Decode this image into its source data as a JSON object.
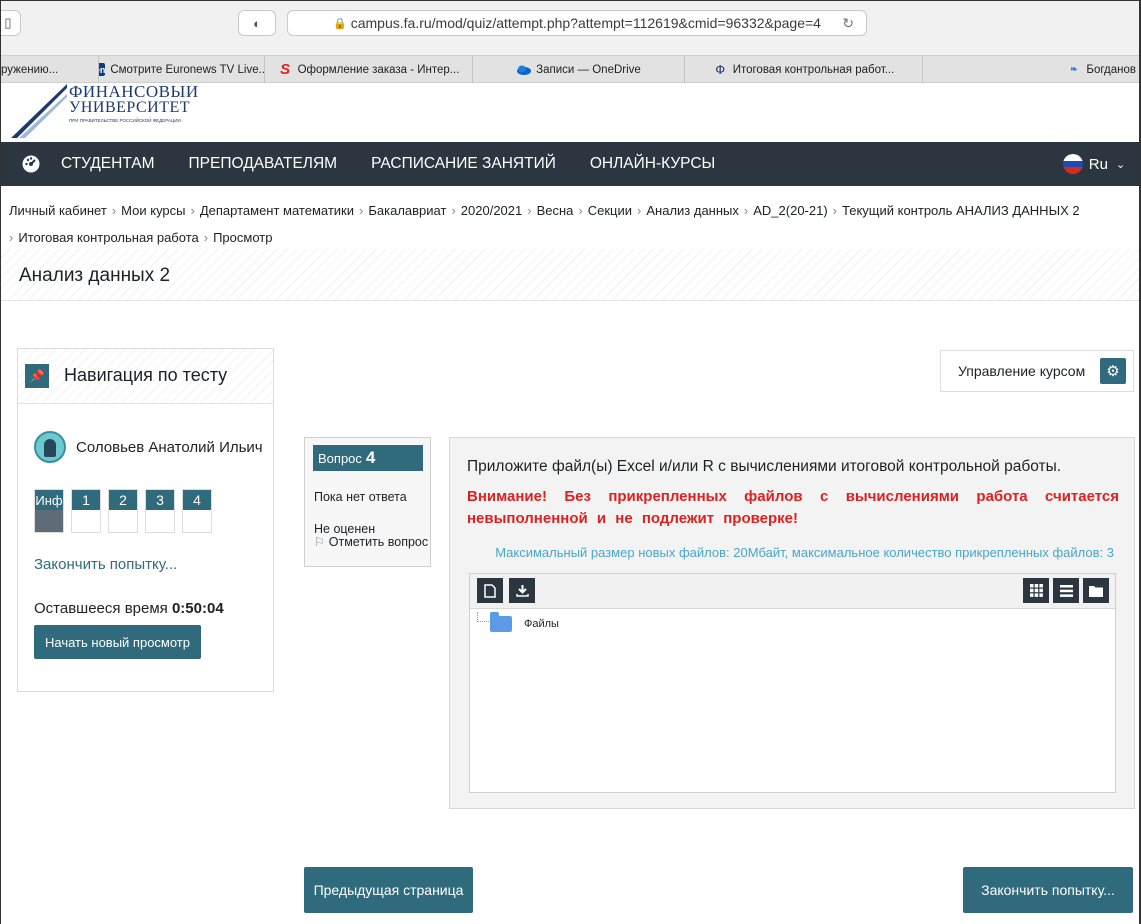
{
  "browser": {
    "url": "campus.fa.ru/mod/quiz/attempt.php?attempt=112619&cmid=96332&page=4",
    "tabs": [
      {
        "label": "ружению...",
        "favicon": ""
      },
      {
        "label": "Смотрите Euronews TV Live...",
        "favicon": "en"
      },
      {
        "label": "Оформление заказа - Интер...",
        "favicon": "S"
      },
      {
        "label": "Записи — OneDrive",
        "favicon": "cloud"
      },
      {
        "label": "Итоговая контрольная работ...",
        "favicon": "Ф"
      },
      {
        "label": "Богданов",
        "favicon": "leaf"
      }
    ]
  },
  "logo": {
    "line1": "ФИНАНСОВЫЙ",
    "line2": "УНИВЕРСИТЕТ",
    "line3": "ПРИ ПРАВИТЕЛЬСТВЕ РОССИЙСКОЙ ФЕДЕРАЦИИ"
  },
  "nav": {
    "items": [
      "СТУДЕНТАМ",
      "ПРЕПОДАВАТЕЛЯМ",
      "РАСПИСАНИЕ ЗАНЯТИЙ",
      "ОНЛАЙН-КУРСЫ"
    ],
    "lang": "Ru"
  },
  "breadcrumb": [
    "Личный кабинет",
    "Мои курсы",
    "Департамент математики",
    "Бакалавриат",
    "2020/2021",
    "Весна",
    "Секции",
    "Анализ данных",
    "AD_2(20-21)",
    "Текущий контроль АНАЛИЗ ДАННЫХ 2",
    "Итоговая контрольная работа",
    "Просмотр"
  ],
  "page_title": "Анализ данных 2",
  "quiz_nav": {
    "title": "Навигация по тесту",
    "user": "Соловьев Анатолий Ильич",
    "buttons": [
      "Инф",
      "1",
      "2",
      "3",
      "4"
    ],
    "finish_link": "Закончить попытку...",
    "time_label": "Оставшееся время",
    "time_value": "0:50:04",
    "new_review": "Начать новый просмотр"
  },
  "question_info": {
    "label": "Вопрос",
    "number": "4",
    "state": "Пока нет ответа",
    "grade": "Не оценен",
    "flag": "Отметить вопрос"
  },
  "question": {
    "text": "Приложите файл(ы) Excel и/или R с вычислениями итоговой контрольной работы.",
    "warning": "Внимание! Без прикрепленных файлов с вычислениями работа считается невыполненной и не подлежит проверке!",
    "limits": "Максимальный размер новых файлов: 20Мбайт, максимальное количество прикрепленных файлов: 3",
    "folder": "Файлы"
  },
  "course_admin": "Управление курсом",
  "buttons": {
    "prev": "Предыдущая страница",
    "finish": "Закончить попытку..."
  },
  "colors": {
    "primary": "#2f6b7d",
    "navbar": "#2b3640",
    "warning": "#e02020",
    "info": "#4aa5c9"
  }
}
